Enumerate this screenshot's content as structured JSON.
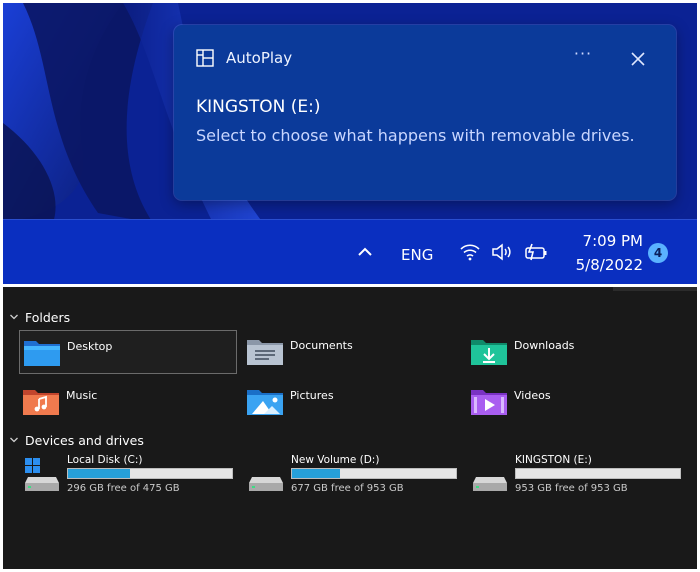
{
  "notification": {
    "app_name": "AutoPlay",
    "title": "KINGSTON (E:)",
    "body": "Select to choose what happens with removable drives.",
    "more_label": "···",
    "app_icon": "autoplay-icon",
    "colors": {
      "background": "#0b3a9a",
      "accent": "#5ab2ff"
    }
  },
  "taskbar": {
    "language": "ENG",
    "time": "7:09 PM",
    "date": "5/8/2022",
    "notification_count": "4",
    "icons": [
      "chevron-up-icon",
      "wifi-icon",
      "volume-icon",
      "battery-charging-icon"
    ]
  },
  "explorer": {
    "folders_heading": "Folders",
    "folders": [
      {
        "label": "Desktop",
        "icon": "desktop-folder-icon",
        "selected": true
      },
      {
        "label": "Documents",
        "icon": "documents-folder-icon"
      },
      {
        "label": "Downloads",
        "icon": "downloads-folder-icon"
      },
      {
        "label": "Music",
        "icon": "music-folder-icon"
      },
      {
        "label": "Pictures",
        "icon": "pictures-folder-icon"
      },
      {
        "label": "Videos",
        "icon": "videos-folder-icon"
      }
    ],
    "devices_heading": "Devices and drives",
    "drives": [
      {
        "name": "Local Disk (C:)",
        "free_text": "296 GB free of 475 GB",
        "used_fraction": 0.377,
        "icon": "system-drive-icon"
      },
      {
        "name": "New Volume (D:)",
        "free_text": "677 GB free of 953 GB",
        "used_fraction": 0.29,
        "icon": "drive-icon"
      },
      {
        "name": "KINGSTON (E:)",
        "free_text": "953 GB free of 953 GB",
        "used_fraction": 0.0,
        "icon": "drive-icon"
      }
    ],
    "colors": {
      "usage_bar": "#26a0da"
    }
  }
}
